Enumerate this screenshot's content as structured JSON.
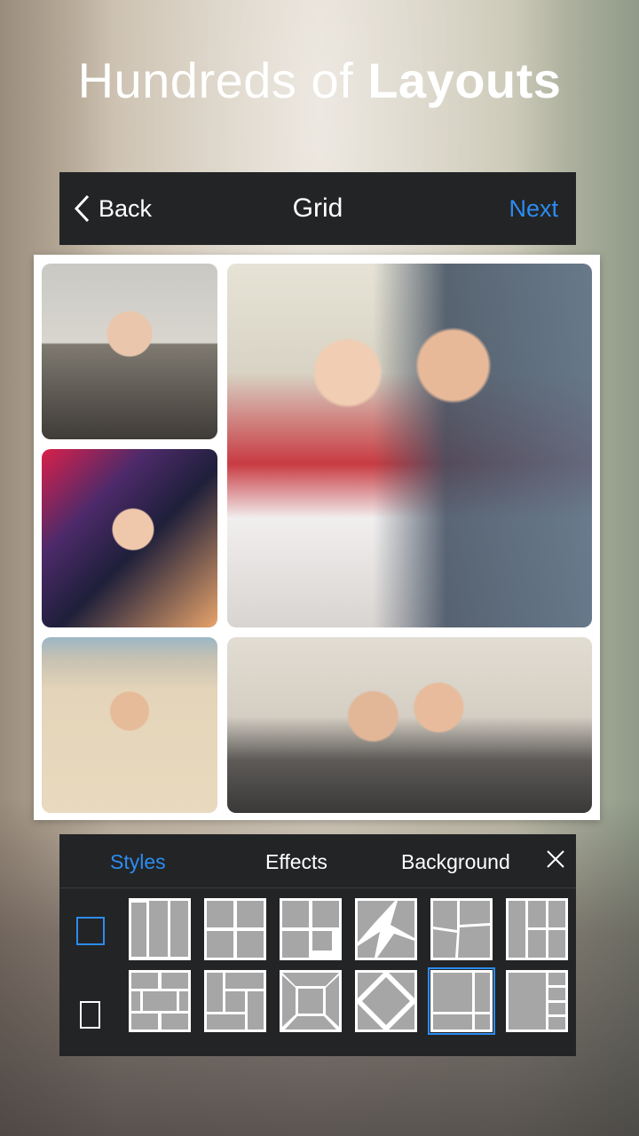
{
  "headline": {
    "normal": "Hundreds of ",
    "bold": "Layouts"
  },
  "topbar": {
    "back_label": "Back",
    "title": "Grid",
    "next_label": "Next"
  },
  "tabs": [
    {
      "label": "Styles",
      "active": true
    },
    {
      "label": "Effects",
      "active": false
    },
    {
      "label": "Background",
      "active": false
    }
  ],
  "colors": {
    "accent": "#2b8cf0",
    "bar": "#232426",
    "cell": "#a6a6a6"
  },
  "layout_thumbnails": {
    "rows": 2,
    "per_row": 6,
    "selected_row": 2,
    "selected_col": 5
  },
  "icons": [
    "chevron-left-icon",
    "close-icon",
    "square-ratio-icon",
    "portrait-ratio-icon"
  ]
}
